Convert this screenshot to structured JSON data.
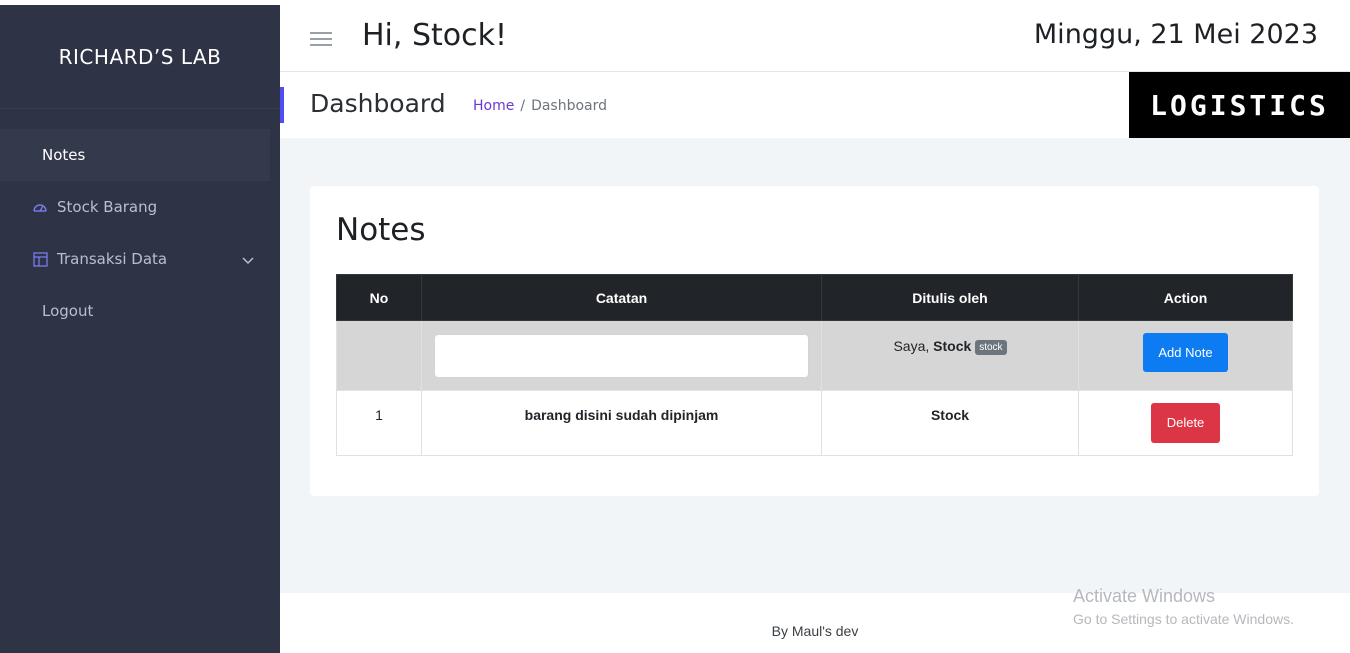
{
  "sidebar": {
    "brand": "RICHARD’S LAB",
    "items": [
      {
        "label": "Notes",
        "active": true
      },
      {
        "label": "Stock Barang",
        "icon": "dashboard-gauge-icon"
      },
      {
        "label": "Transaksi Data",
        "icon": "layout-panel-icon",
        "has_submenu": true
      },
      {
        "label": "Logout"
      }
    ]
  },
  "header": {
    "greeting": "Hi, Stock!",
    "date": "Minggu, 21 Mei 2023"
  },
  "subheader": {
    "title": "Dashboard",
    "breadcrumb_home": "Home",
    "breadcrumb_sep": "/",
    "breadcrumb_current": "Dashboard",
    "logo_text": "LOGISTICS"
  },
  "notes": {
    "title": "Notes",
    "columns": [
      "No",
      "Catatan",
      "Ditulis oleh",
      "Action"
    ],
    "input_row": {
      "note_value": "",
      "author_prefix": "Saya,",
      "author_name": "Stock",
      "author_badge": "stock",
      "add_button": "Add Note"
    },
    "rows": [
      {
        "no": "1",
        "catatan": "barang disini sudah dipinjam",
        "author": "Stock",
        "action": "Delete"
      }
    ]
  },
  "footer": {
    "text": "By Maul's dev"
  },
  "watermark": {
    "line1": "Activate Windows",
    "line2": "Go to Settings to activate Windows."
  },
  "colors": {
    "sidebar_bg": "#2e3445",
    "accent": "#4f4ef2",
    "primary_button": "#0d7cf2",
    "danger_button": "#dc3545",
    "table_header": "#212529"
  }
}
